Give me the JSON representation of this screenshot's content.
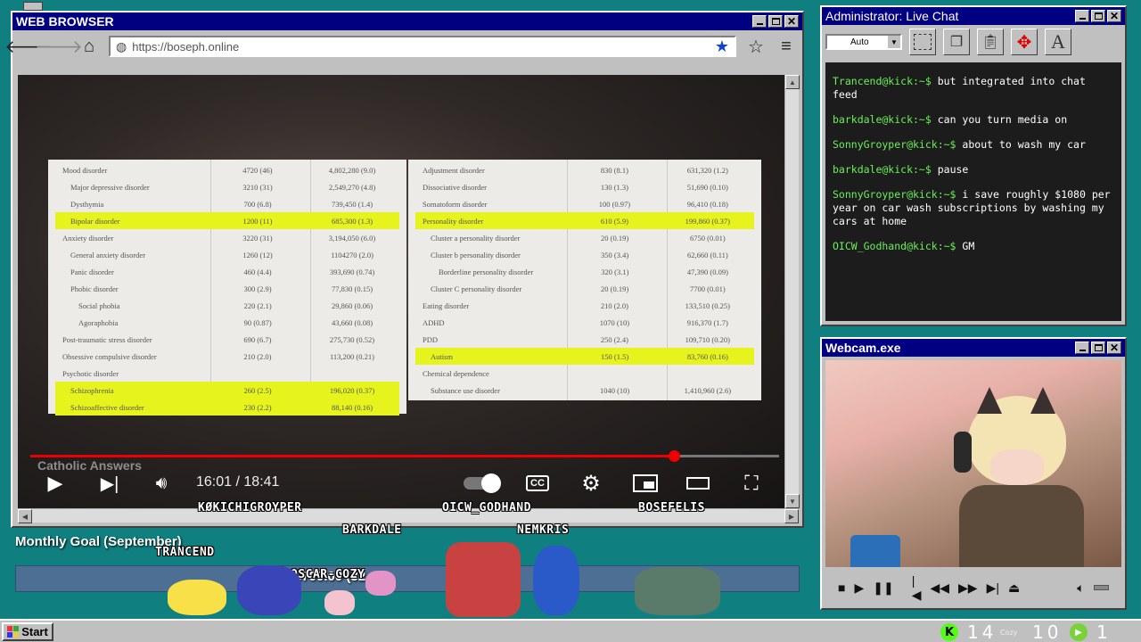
{
  "browser": {
    "title": "WEB BROWSER",
    "url": "https://boseph.online",
    "video": {
      "watermark": "Catholic Answers",
      "time_current": "16:01",
      "time_total": "18:41",
      "progress": 0.86,
      "left_rows": [
        {
          "name": "Mood disorder",
          "a": "4720 (46)",
          "b": "4,802,280 (9.0)",
          "indent": 0,
          "hl": false
        },
        {
          "name": "Major depressive disorder",
          "a": "3210 (31)",
          "b": "2,549,270 (4.8)",
          "indent": 1,
          "hl": false
        },
        {
          "name": "Dysthymia",
          "a": "700 (6.8)",
          "b": "739,450 (1.4)",
          "indent": 1,
          "hl": false
        },
        {
          "name": "Bipolar disorder",
          "a": "1200 (11)",
          "b": "685,300 (1.3)",
          "indent": 1,
          "hl": true
        },
        {
          "name": "Anxiety disorder",
          "a": "3220 (31)",
          "b": "3,194,050 (6.0)",
          "indent": 0,
          "hl": false
        },
        {
          "name": "General anxiety disorder",
          "a": "1260 (12)",
          "b": "1104270 (2.0)",
          "indent": 1,
          "hl": false
        },
        {
          "name": "Panic disorder",
          "a": "460 (4.4)",
          "b": "393,690 (0.74)",
          "indent": 1,
          "hl": false
        },
        {
          "name": "Phobic disorder",
          "a": "300 (2.9)",
          "b": "77,830 (0.15)",
          "indent": 1,
          "hl": false
        },
        {
          "name": "Social phobia",
          "a": "220 (2.1)",
          "b": "29,860 (0.06)",
          "indent": 2,
          "hl": false
        },
        {
          "name": "Agoraphobia",
          "a": "90 (0.87)",
          "b": "43,660 (0.08)",
          "indent": 2,
          "hl": false
        },
        {
          "name": "Post-traumatic stress disorder",
          "a": "690 (6.7)",
          "b": "275,730 (0.52)",
          "indent": 0,
          "hl": false
        },
        {
          "name": "Obsessive compulsive disorder",
          "a": "210 (2.0)",
          "b": "113,200 (0.21)",
          "indent": 0,
          "hl": false
        },
        {
          "name": "Psychotic disorder",
          "a": "",
          "b": "",
          "indent": 0,
          "hl": false
        },
        {
          "name": "Schizophrenia",
          "a": "260 (2.5)",
          "b": "196,020 (0.37)",
          "indent": 1,
          "hl": true
        },
        {
          "name": "Schizoaffective disorder",
          "a": "230 (2.2)",
          "b": "88,140 (0.16)",
          "indent": 1,
          "hl": true
        }
      ],
      "right_rows": [
        {
          "name": "Adjustment disorder",
          "a": "830 (8.1)",
          "b": "631,320 (1.2)",
          "indent": 0,
          "hl": false
        },
        {
          "name": "Dissociative disorder",
          "a": "130 (1.3)",
          "b": "51,690 (0.10)",
          "indent": 0,
          "hl": false
        },
        {
          "name": "Somatoform disorder",
          "a": "100 (0.97)",
          "b": "96,410 (0.18)",
          "indent": 0,
          "hl": false
        },
        {
          "name": "Personality disorder",
          "a": "610 (5.9)",
          "b": "199,860 (0.37)",
          "indent": 0,
          "hl": true
        },
        {
          "name": "Cluster a personality disorder",
          "a": "20 (0.19)",
          "b": "6750 (0.01)",
          "indent": 1,
          "hl": false
        },
        {
          "name": "Cluster b personality disorder",
          "a": "350 (3.4)",
          "b": "62,660 (0.11)",
          "indent": 1,
          "hl": false
        },
        {
          "name": "Borderline personality disorder",
          "a": "320 (3.1)",
          "b": "47,390 (0.09)",
          "indent": 2,
          "hl": false
        },
        {
          "name": "Cluster C personality disorder",
          "a": "20 (0.19)",
          "b": "7700 (0.01)",
          "indent": 1,
          "hl": false
        },
        {
          "name": "Eating disorder",
          "a": "210 (2.0)",
          "b": "133,510 (0.25)",
          "indent": 0,
          "hl": false
        },
        {
          "name": "ADHD",
          "a": "1070 (10)",
          "b": "916,370 (1.7)",
          "indent": 0,
          "hl": false
        },
        {
          "name": "PDD",
          "a": "250 (2.4)",
          "b": "109,710 (0.20)",
          "indent": 0,
          "hl": false
        },
        {
          "name": "Autism",
          "a": "150 (1.5)",
          "b": "83,760 (0.16)",
          "indent": 1,
          "hl": true
        },
        {
          "name": "Chemical dependence",
          "a": "",
          "b": "",
          "indent": 0,
          "hl": false
        },
        {
          "name": "Substance use disorder",
          "a": "1040 (10)",
          "b": "1,410,960 (2.6)",
          "indent": 1,
          "hl": false
        }
      ]
    }
  },
  "chat": {
    "title": "Administrator: Live Chat",
    "font_select": "Auto",
    "messages": [
      {
        "user": "Trancend@kick:~$",
        "text": "but integrated into chat feed"
      },
      {
        "user": "barkdale@kick:~$",
        "text": "can you turn media on"
      },
      {
        "user": "SonnyGroyper@kick:~$",
        "text": "about to wash my car"
      },
      {
        "user": "barkdale@kick:~$",
        "text": "pause"
      },
      {
        "user": "SonnyGroyper@kick:~$",
        "text": "i save roughly $1080 per year on car wash subscriptions by washing my cars at home"
      },
      {
        "user": "OICW_Godhand@kick:~$",
        "text": "GM"
      }
    ]
  },
  "webcam": {
    "title": "Webcam.exe"
  },
  "overlay": {
    "goal_label": "Monthly Goal (September)",
    "goal_text": "$700.00 (32",
    "viewers": [
      {
        "name": "KØKICHIGROYPER"
      },
      {
        "name": "OICW_GODHAND"
      },
      {
        "name": "BOSEFELIS"
      },
      {
        "name": "BARKDALE"
      },
      {
        "name": "NEMKRIS"
      },
      {
        "name": "TRANCEND"
      },
      {
        "name": "OSCAR-COZY"
      }
    ]
  },
  "taskbar": {
    "start": "Start",
    "kick_count": "14",
    "cozy_label": "Cozy",
    "cozy_count": "10",
    "other_count": "1"
  },
  "colors": {
    "titlebar": "#000080",
    "desktop": "#0f7f80",
    "chat_user": "#6cf05a",
    "highlight": "#e6f31c",
    "progress": "#e00000"
  }
}
